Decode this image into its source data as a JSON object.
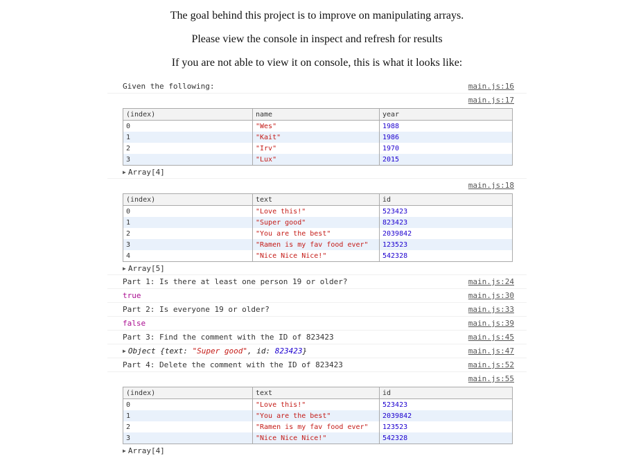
{
  "intro": {
    "line1": "The goal behind this project is to improve on manipulating arrays.",
    "line2": "Please view the console in inspect and refresh for results",
    "line3": "If you are not able to view it on console, this is what it looks like:"
  },
  "console": {
    "given": {
      "text": "Given the following:",
      "src": "main.js:16"
    },
    "src17": "main.js:17",
    "people": {
      "headers": [
        "(index)",
        "name",
        "year"
      ],
      "rows": [
        [
          "0",
          "\"Wes\"",
          "1988"
        ],
        [
          "1",
          "\"Kait\"",
          "1986"
        ],
        [
          "2",
          "\"Irv\"",
          "1970"
        ],
        [
          "3",
          "\"Lux\"",
          "2015"
        ]
      ],
      "summary": "Array[4]"
    },
    "src18": "main.js:18",
    "comments": {
      "headers": [
        "(index)",
        "text",
        "id"
      ],
      "rows": [
        [
          "0",
          "\"Love this!\"",
          "523423"
        ],
        [
          "1",
          "\"Super good\"",
          "823423"
        ],
        [
          "2",
          "\"You are the best\"",
          "2039842"
        ],
        [
          "3",
          "\"Ramen is my fav food ever\"",
          "123523"
        ],
        [
          "4",
          "\"Nice Nice Nice!\"",
          "542328"
        ]
      ],
      "summary": "Array[5]"
    },
    "part1": {
      "text": "Part 1: Is there at least one person 19 or older?",
      "src": "main.js:24"
    },
    "res1": {
      "text": "true",
      "src": "main.js:30"
    },
    "part2": {
      "text": "Part 2: Is everyone 19 or older?",
      "src": "main.js:33"
    },
    "res2": {
      "text": "false",
      "src": "main.js:39"
    },
    "part3": {
      "text": "Part 3: Find the comment with the ID of 823423",
      "src": "main.js:45"
    },
    "res3": {
      "prefix": "Object {",
      "k1": "text: ",
      "v1": "\"Super good\"",
      "sep": ", ",
      "k2": "id: ",
      "v2": "823423",
      "suffix": "}",
      "src": "main.js:47"
    },
    "part4": {
      "text": "Part 4: Delete the comment with the ID of 823423",
      "src": "main.js:52"
    },
    "src55": "main.js:55",
    "remaining": {
      "headers": [
        "(index)",
        "text",
        "id"
      ],
      "rows": [
        [
          "0",
          "\"Love this!\"",
          "523423"
        ],
        [
          "1",
          "\"You are the best\"",
          "2039842"
        ],
        [
          "2",
          "\"Ramen is my fav food ever\"",
          "123523"
        ],
        [
          "3",
          "\"Nice Nice Nice!\"",
          "542328"
        ]
      ],
      "summary": "Array[4]"
    }
  }
}
